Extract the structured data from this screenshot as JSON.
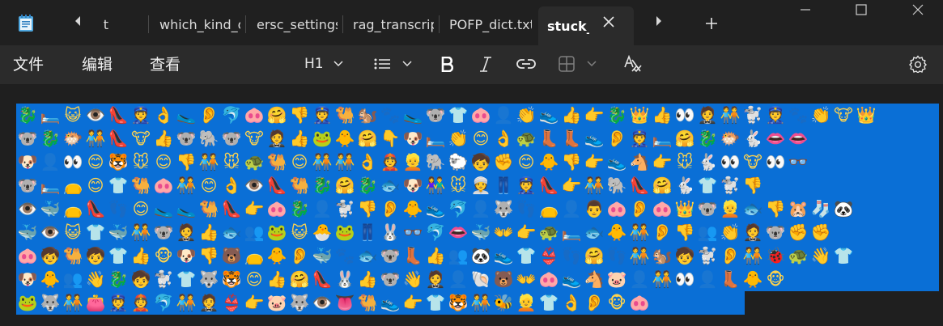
{
  "tabs": [
    {
      "label": "t"
    },
    {
      "label": "which_kind_o"
    },
    {
      "label": "ersc_settings"
    },
    {
      "label": "rag_transcrip"
    },
    {
      "label": "POFP_dict.txt"
    },
    {
      "label": "stuck_",
      "active": true
    }
  ],
  "menu": {
    "file": "文件",
    "edit": "编辑",
    "view": "查看"
  },
  "toolbar": {
    "heading": "H1",
    "icons": [
      "list-icon",
      "bold-icon",
      "italic-icon",
      "link-icon",
      "table-icon",
      "spellcheck-icon",
      "settings-icon"
    ]
  },
  "colors": {
    "selection_bg": "#0a6fd6",
    "window_bg": "#1f1f1f",
    "toolbar_bg": "#2b2b2b"
  },
  "emoji_rows": [
    "🐉🛏️😺👁️👠👮👌🥿👂🐬🐽🤗👎👮🐫🐿️🐾🥿🐨👕🐽👤👏👟👍👉🐉👑👍👀🤵🧑‍🤝‍🧑🐩👮🐾👏🐮👑",
    "🐨🐉🐡🧑‍🤝‍🧑👠🐮👍🐨🐘🐨🐮🤵👍🐸🐥🤗👇🐶🛏️👏😊👌🐢👢👢👟👂👮🛏️🤗🐉🐡🐇👄👄",
    "🐶👤👀😊🐯🐭😊👎🧑‍🤝‍🧑🐭🐢🐫😊🧑‍🤝‍🧑🧑‍🤝‍🧑👌👲👱🐘🐑🧒✊😊🐥👎👉👟🐴👉🐭🐇👀🐮👀👓",
    "🐨🛏️👝😊👕🐫🐽🧑‍🤝‍🧑😊👌👁️👠🐫🐉🤗🐉🐟🐶👫🐭👳👖👮👠👉🧑‍🤝‍🧑🐘👠🤗🐇👕🐩👎",
    "👁️🐳👝👠👣😊🥿🥿🐫👠👉🐽🐉👤🐩👎👂🐥👟🐬👤🐺👣👝👤👨🐽👂🐽👑🐨👱🐟👎🐹🧦🐼",
    "🐳👁️😺👕🐳🧑‍🤝‍🧑🐨🤵👍🐟👥🐸😺🐣🐸👖🐰👓🐬👄🐳👐👉🐢🛏️🐟🐥🧑‍🤝‍🧑👂👎👥👏🤵🐨✊✊",
    "🐽🧒🐫🧒👕👍🐵🐶👎🐻👝🐥👂🐳🐾🐟🐨👢👍👥🐼👟👕👙👣🤗👣🧑‍🤝‍🧑🐿️🧒🐩👂🧑‍🤝‍🧑🐞🐢👋👕",
    "🐶🐥👥👋🐉🧒🐩👕🐺🐯😊👍🤗👠🐰👍🐨👋🤵👤🐚🐻👐🐽👟🐴🐷👤🧑‍🤝‍🧑👀👤👢🐥🐵",
    "🐸🐺🧑‍🤝‍🧑👛👮👲🐬🧑‍🤝‍🧑🤵👙👉🐷🐺👁️👅🐫👟👉👕🐯🧑‍🤝‍🧑🐝👱👕👌👂🐵🐽"
  ]
}
